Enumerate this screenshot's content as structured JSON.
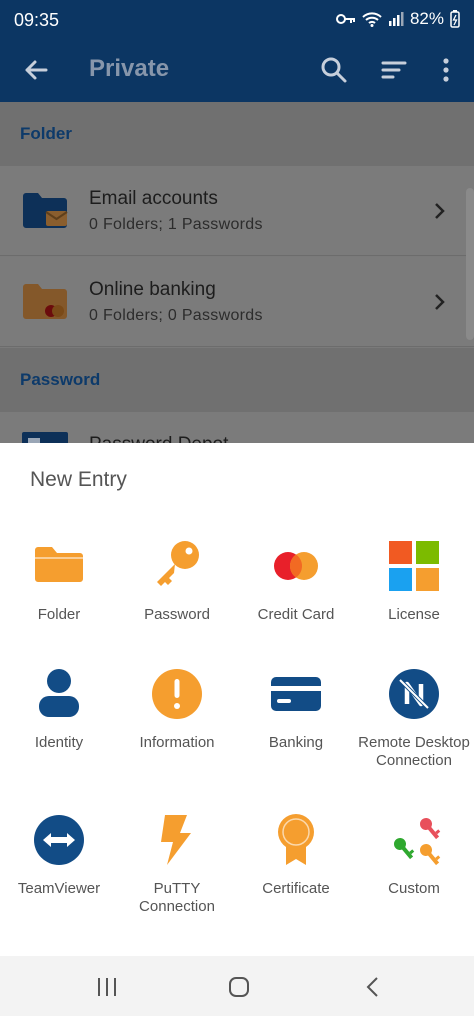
{
  "status": {
    "time": "09:35",
    "battery": "82%"
  },
  "appbar": {
    "title": "Private"
  },
  "sections": {
    "folder": "Folder",
    "password": "Password"
  },
  "folders": [
    {
      "name": "Email accounts",
      "detail": "0 Folders; 1 Passwords"
    },
    {
      "name": "Online banking",
      "detail": "0 Folders; 0 Passwords"
    }
  ],
  "password_entry": {
    "name": "Password Depot"
  },
  "sheet": {
    "title": "New Entry",
    "items": [
      {
        "label": "Folder",
        "icon": "folder-icon"
      },
      {
        "label": "Password",
        "icon": "key-icon"
      },
      {
        "label": "Credit Card",
        "icon": "credit-card-icon"
      },
      {
        "label": "License",
        "icon": "license-icon"
      },
      {
        "label": "Identity",
        "icon": "identity-icon"
      },
      {
        "label": "Information",
        "icon": "information-icon"
      },
      {
        "label": "Banking",
        "icon": "banking-icon"
      },
      {
        "label": "Remote Desktop\nConnection",
        "icon": "remote-desktop-icon"
      },
      {
        "label": "TeamViewer",
        "icon": "teamviewer-icon"
      },
      {
        "label": "PuTTY\nConnection",
        "icon": "putty-icon"
      },
      {
        "label": "Certificate",
        "icon": "certificate-icon"
      },
      {
        "label": "Custom",
        "icon": "custom-icon"
      }
    ]
  },
  "colors": {
    "primary": "#0c3663",
    "accent": "#f59e2f",
    "icon_blue": "#124c86"
  }
}
